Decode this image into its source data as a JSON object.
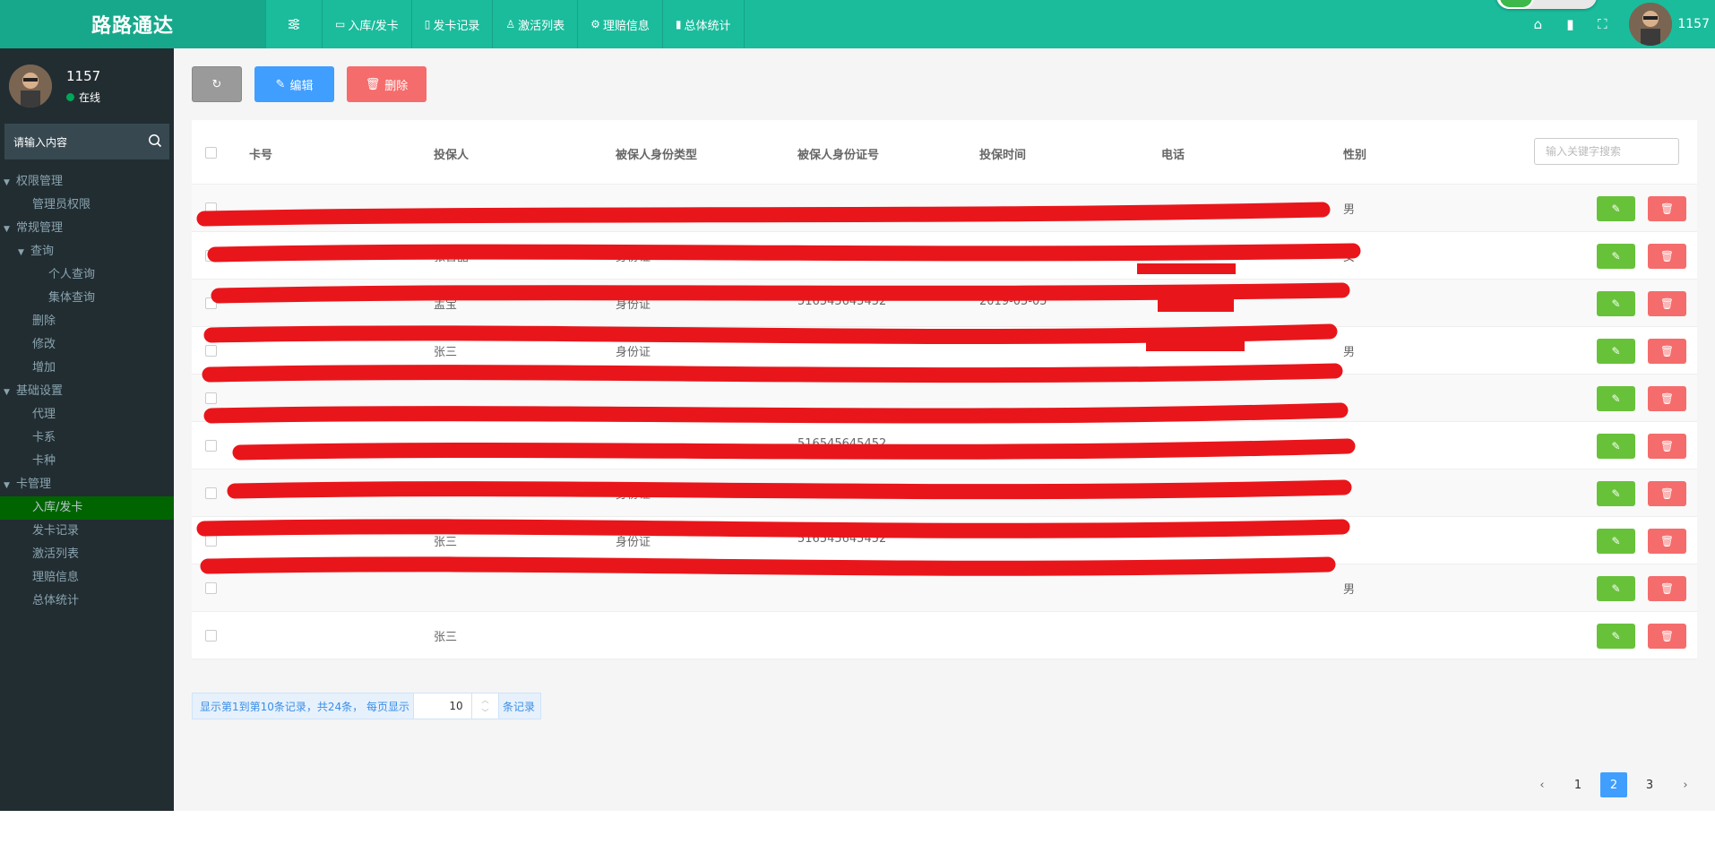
{
  "header": {
    "logo": "路路通达",
    "nav": [
      {
        "label": "入库/发卡",
        "icon": "card-icon"
      },
      {
        "label": "发卡记录",
        "icon": "trash-icon"
      },
      {
        "label": "激活列表",
        "icon": "user-icon"
      },
      {
        "label": "理赔信息",
        "icon": "settings-icon"
      },
      {
        "label": "总体统计",
        "icon": "bar-chart-icon"
      }
    ],
    "username": "1157"
  },
  "sidebar": {
    "username": "1157",
    "status": "在线",
    "search_placeholder": "请输入内容",
    "menu": [
      {
        "label": "权限管理",
        "level": 0,
        "expanded": true
      },
      {
        "label": "管理员权限",
        "level": 1
      },
      {
        "label": "常规管理",
        "level": 0,
        "expanded": true
      },
      {
        "label": "查询",
        "level": "1g",
        "expanded": true
      },
      {
        "label": "个人查询",
        "level": 2
      },
      {
        "label": "集体查询",
        "level": 2
      },
      {
        "label": "删除",
        "level": 1
      },
      {
        "label": "修改",
        "level": 1
      },
      {
        "label": "增加",
        "level": 1
      },
      {
        "label": "基础设置",
        "level": 0,
        "expanded": true
      },
      {
        "label": "代理",
        "level": 1
      },
      {
        "label": "卡系",
        "level": 1
      },
      {
        "label": "卡种",
        "level": 1
      },
      {
        "label": "卡管理",
        "level": 0,
        "expanded": true
      },
      {
        "label": "入库/发卡",
        "level": 1,
        "active": true
      },
      {
        "label": "发卡记录",
        "level": 1
      },
      {
        "label": "激活列表",
        "level": 1
      },
      {
        "label": "理赔信息",
        "level": 1
      },
      {
        "label": "总体统计",
        "level": 1
      }
    ]
  },
  "toolbar": {
    "edit_label": "编辑",
    "delete_label": "删除"
  },
  "table": {
    "columns": [
      "卡号",
      "投保人",
      "被保人身份类型",
      "被保人身份证号",
      "投保时间",
      "电话",
      "性别"
    ],
    "search_placeholder": "输入关键字搜索",
    "rows": [
      {
        "insurer": "",
        "id_type": "",
        "id_no": "",
        "time": "",
        "gender": "男"
      },
      {
        "insurer": "张晋晶",
        "id_type": "身份证",
        "id_no": "516545645452",
        "time": "2019-05-05",
        "gender": "女"
      },
      {
        "insurer": "孟宝",
        "id_type": "身份证",
        "id_no": "516545645452",
        "time": "2019-05-05",
        "gender": ""
      },
      {
        "insurer": "张三",
        "id_type": "身份证",
        "id_no": "",
        "time": "",
        "gender": "男"
      },
      {
        "insurer": "",
        "id_type": "",
        "id_no": "",
        "time": "",
        "gender": ""
      },
      {
        "insurer": "",
        "id_type": "",
        "id_no": "516545645452",
        "time": "",
        "gender": ""
      },
      {
        "insurer": "",
        "id_type": "身份证",
        "id_no": "",
        "time": "",
        "gender": ""
      },
      {
        "insurer": "张三",
        "id_type": "身份证",
        "id_no": "516545645452",
        "time": "",
        "gender": ""
      },
      {
        "insurer": "",
        "id_type": "",
        "id_no": "",
        "time": "",
        "gender": "男"
      },
      {
        "insurer": "张三",
        "id_type": "",
        "id_no": "",
        "time": "",
        "gender": ""
      }
    ]
  },
  "pager": {
    "info": "显示第1到第10条记录，共24条，  每页显示",
    "page_size": "10",
    "suffix": "条记录",
    "pages": [
      "1",
      "2",
      "3"
    ],
    "current": "2"
  },
  "colors": {
    "header": "#1abc9c",
    "sidebar": "#222d32",
    "active_menu": "#006400",
    "primary": "#409eff",
    "danger": "#f56c6c",
    "success": "#67c23a",
    "redaction": "#e8161b"
  }
}
